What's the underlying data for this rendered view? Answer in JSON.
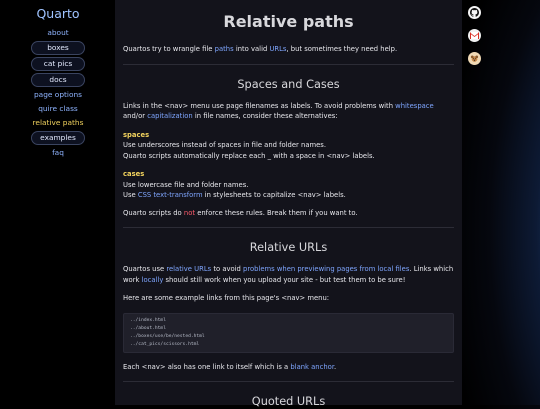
{
  "site_title": "Quarto",
  "nav": [
    {
      "label": "about",
      "style": "plain"
    },
    {
      "label": "boxes",
      "style": "box"
    },
    {
      "label": "cat pics",
      "style": "box"
    },
    {
      "label": "docs",
      "style": "box"
    },
    {
      "label": "page options",
      "style": "plain"
    },
    {
      "label": "quire class",
      "style": "plain"
    },
    {
      "label": "relative paths",
      "style": "current"
    },
    {
      "label": "examples",
      "style": "box"
    },
    {
      "label": "faq",
      "style": "plain"
    }
  ],
  "icons": [
    "github-icon",
    "gmail-icon",
    "avatar-dog-icon"
  ],
  "title": "Relative paths",
  "intro": {
    "a": "Quartos try to wrangle file ",
    "link1": "paths",
    "b": " into valid ",
    "link2": "URLs",
    "c": ", but sometimes they need help."
  },
  "section1": {
    "heading": "Spaces and Cases",
    "p1a": "Links in the <nav> menu use page filenames as labels. To avoid problems with ",
    "p1link1": "whitespace",
    "p1b": " and/or ",
    "p1link2": "capitalization",
    "p1c": " in file names, consider these alternatives:",
    "spaces_label": "spaces",
    "spaces_l1": "Use underscores instead of spaces in file and folder names.",
    "spaces_l2": "Quarto scripts automatically replace each _ with a space in <nav> labels.",
    "cases_label": "cases",
    "cases_l1": "Use lowercase file and folder names.",
    "cases_l2a": "Use ",
    "cases_link": "CSS text-transform",
    "cases_l2b": " in stylesheets to capitalize <nav> labels.",
    "note_a": "Quarto scripts do ",
    "note_red": "not",
    "note_b": " enforce these rules. Break them if you want to."
  },
  "section2": {
    "heading": "Relative URLs",
    "p1a": "Quartos use ",
    "p1link1": "relative URLs",
    "p1b": " to avoid ",
    "p1link2": "problems when previewing pages from local files",
    "p1c": ". Links which work ",
    "p1link3": "locally",
    "p1d": " should still work when you upload your site - but test them to be sure!",
    "p2": "Here are some example links from this page's <nav> menu:",
    "code": [
      "../index.html",
      "../about.html",
      "../boxes/use/be/nested.html",
      "../cat_pics/scissors.html"
    ],
    "p3a": "Each <nav> also has one link to itself which is a ",
    "p3link": "blank anchor",
    "p3b": "."
  },
  "section3": {
    "heading": "Quoted URLs"
  }
}
